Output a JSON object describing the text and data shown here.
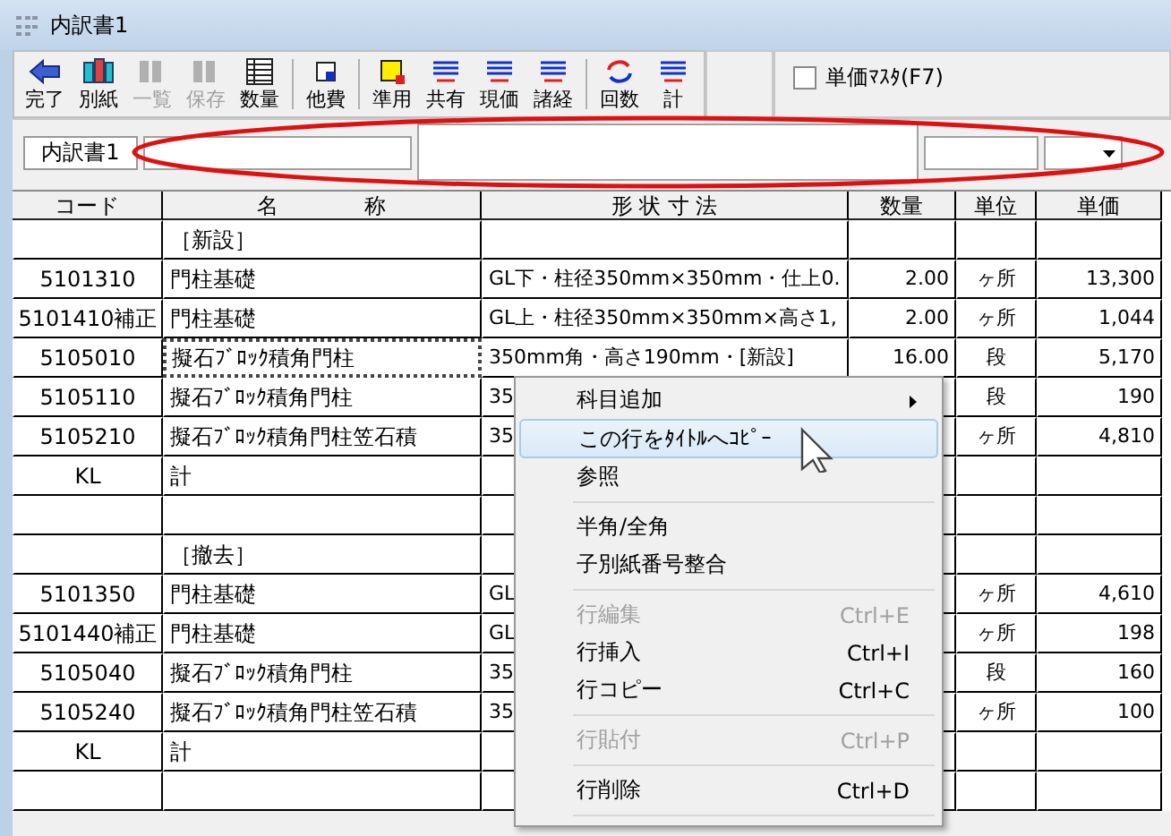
{
  "window": {
    "title": "内訳書1"
  },
  "toolbar": {
    "groups": [
      [
        {
          "label": "完了",
          "kind": "back",
          "disabled": false
        },
        {
          "label": "別紙",
          "kind": "sheets",
          "disabled": false
        },
        {
          "label": "一覧",
          "kind": "sheets",
          "disabled": true
        },
        {
          "label": "保存",
          "kind": "sheets",
          "disabled": true
        },
        {
          "label": "数量",
          "kind": "grid",
          "disabled": false
        }
      ],
      [
        {
          "label": "他費",
          "kind": "square",
          "disabled": false
        }
      ],
      [
        {
          "label": "準用",
          "kind": "note",
          "disabled": false
        },
        {
          "label": "共有",
          "kind": "lines",
          "disabled": false
        },
        {
          "label": "現価",
          "kind": "lines",
          "disabled": false
        },
        {
          "label": "諸経",
          "kind": "lines",
          "disabled": false
        }
      ],
      [
        {
          "label": "回数",
          "kind": "refresh",
          "disabled": false
        },
        {
          "label": "計",
          "kind": "lines",
          "disabled": false
        }
      ]
    ],
    "checkbox": {
      "label": "単価ﾏｽﾀ(F7)",
      "checked": false
    }
  },
  "title_row": {
    "label": "内訳書1"
  },
  "table": {
    "columns": [
      "コード",
      "名　　　　称",
      "形 状 寸 法",
      "数量",
      "単位",
      "単価"
    ],
    "rows": [
      {
        "code": "",
        "name": "［新設］",
        "spec": "",
        "qty": "",
        "unit": "",
        "price": "",
        "selected": false
      },
      {
        "code": "5101310",
        "name": "門柱基礎",
        "spec": "GL下・柱径350mm×350mm・仕上0.",
        "qty": "2.00",
        "unit": "ヶ所",
        "price": "13,300",
        "selected": false
      },
      {
        "code": "5101410補正",
        "name": "門柱基礎",
        "spec": "GL上・柱径350mm×350mm×高さ1,",
        "qty": "2.00",
        "unit": "ヶ所",
        "price": "1,044",
        "selected": false
      },
      {
        "code": "5105010",
        "name": "擬石ﾌﾞﾛｯｸ積角門柱",
        "spec": "350mm角・高さ190mm・[新設]",
        "qty": "16.00",
        "unit": "段",
        "price": "5,170",
        "selected": true
      },
      {
        "code": "5105110",
        "name": "擬石ﾌﾞﾛｯｸ積角門柱",
        "spec": "35",
        "qty": "",
        "unit": "段",
        "price": "190",
        "selected": false
      },
      {
        "code": "5105210",
        "name": "擬石ﾌﾞﾛｯｸ積角門柱笠石積",
        "spec": "35",
        "qty": "",
        "unit": "ヶ所",
        "price": "4,810",
        "selected": false
      },
      {
        "code": "KL",
        "name": "計",
        "spec": "",
        "qty": "",
        "unit": "",
        "price": "",
        "selected": false
      },
      {
        "code": "",
        "name": "",
        "spec": "",
        "qty": "",
        "unit": "",
        "price": "",
        "selected": false
      },
      {
        "code": "",
        "name": "［撤去］",
        "spec": "",
        "qty": "",
        "unit": "",
        "price": "",
        "selected": false
      },
      {
        "code": "5101350",
        "name": "門柱基礎",
        "spec": "GL",
        "qty": "",
        "unit": "ヶ所",
        "price": "4,610",
        "selected": false
      },
      {
        "code": "5101440補正",
        "name": "門柱基礎",
        "spec": "GL",
        "qty": "",
        "unit": "ヶ所",
        "price": "198",
        "selected": false
      },
      {
        "code": "5105040",
        "name": "擬石ﾌﾞﾛｯｸ積角門柱",
        "spec": "35",
        "qty": "",
        "unit": "段",
        "price": "160",
        "selected": false
      },
      {
        "code": "5105240",
        "name": "擬石ﾌﾞﾛｯｸ積角門柱笠石積",
        "spec": "35",
        "qty": "",
        "unit": "ヶ所",
        "price": "100",
        "selected": false
      },
      {
        "code": "KL",
        "name": "計",
        "spec": "",
        "qty": "",
        "unit": "",
        "price": "",
        "selected": false
      },
      {
        "code": "",
        "name": "",
        "spec": "",
        "qty": "",
        "unit": "",
        "price": "",
        "selected": false
      }
    ]
  },
  "context_menu": {
    "items": [
      {
        "kind": "item",
        "label": "科目追加",
        "submenu": true,
        "selected": false,
        "disabled": false
      },
      {
        "kind": "item",
        "label": "この行をﾀｲﾄﾙへｺﾋﾟｰ",
        "selected": true,
        "disabled": false
      },
      {
        "kind": "item",
        "label": "参照",
        "selected": false,
        "disabled": false
      },
      {
        "kind": "separator"
      },
      {
        "kind": "item",
        "label": "半角/全角",
        "selected": false,
        "disabled": false
      },
      {
        "kind": "item",
        "label": "子別紙番号整合",
        "selected": false,
        "disabled": false
      },
      {
        "kind": "separator"
      },
      {
        "kind": "item",
        "label": "行編集",
        "shortcut": "Ctrl+E",
        "selected": false,
        "disabled": true
      },
      {
        "kind": "item",
        "label": "行挿入",
        "shortcut": "Ctrl+I",
        "selected": false,
        "disabled": false
      },
      {
        "kind": "item",
        "label": "行コピー",
        "shortcut": "Ctrl+C",
        "selected": false,
        "disabled": false
      },
      {
        "kind": "separator"
      },
      {
        "kind": "item",
        "label": "行貼付",
        "shortcut": "Ctrl+P",
        "selected": false,
        "disabled": true
      },
      {
        "kind": "separator"
      },
      {
        "kind": "item",
        "label": "行削除",
        "shortcut": "Ctrl+D",
        "selected": false,
        "disabled": false
      },
      {
        "kind": "separator"
      }
    ]
  }
}
